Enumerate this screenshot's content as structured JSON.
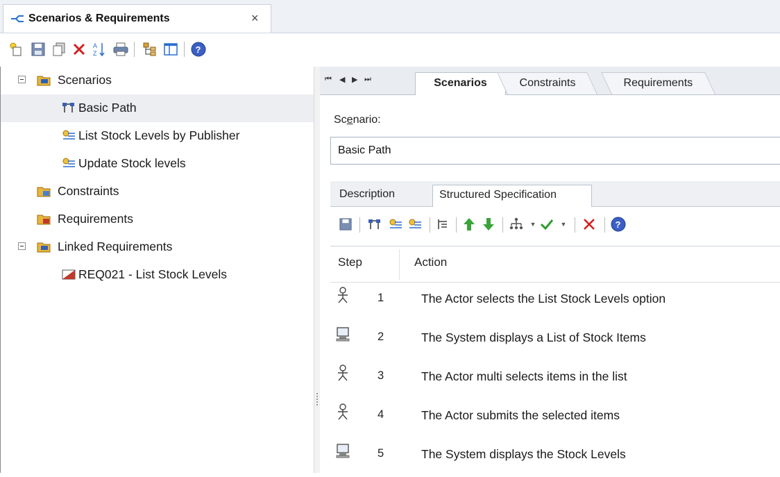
{
  "window": {
    "tab_title": "Scenarios & Requirements",
    "close_glyph": "×"
  },
  "toolbar": {
    "icons": [
      "new-icon",
      "save-icon",
      "copy-icon",
      "delete-icon",
      "sort-icon",
      "print-icon",
      "hierarchy-icon",
      "layout-icon",
      "help-icon"
    ]
  },
  "tree": {
    "items": [
      {
        "label": "Scenarios",
        "icon": "scenarios-folder-icon",
        "expanded": true,
        "level": 0
      },
      {
        "label": "Basic Path",
        "icon": "basic-path-icon",
        "level": 1,
        "selected": true
      },
      {
        "label": "List Stock Levels by Publisher",
        "icon": "alternate-path-icon",
        "level": 1
      },
      {
        "label": "Update Stock levels",
        "icon": "alternate-path-icon",
        "level": 1
      },
      {
        "label": "Constraints",
        "icon": "constraints-folder-icon",
        "level": 0
      },
      {
        "label": "Requirements",
        "icon": "requirements-folder-icon",
        "level": 0
      },
      {
        "label": "Linked Requirements",
        "icon": "linked-requirements-folder-icon",
        "expanded": true,
        "level": 0
      },
      {
        "label": "REQ021 - List Stock Levels",
        "icon": "requirement-icon",
        "level": 1
      }
    ]
  },
  "panel": {
    "nav": [
      "first-icon",
      "previous-icon",
      "next-icon",
      "last-icon"
    ],
    "tabs": [
      {
        "label": "Scenarios",
        "active": true
      },
      {
        "label": "Constraints",
        "active": false
      },
      {
        "label": "Requirements",
        "active": false
      }
    ],
    "scenario_label_pre": "Sc",
    "scenario_label_key": "e",
    "scenario_label_post": "nario:",
    "scenario_value": "Basic Path",
    "sub_tabs": [
      {
        "label": "Description",
        "active": false
      },
      {
        "label": "Structured Specification",
        "active": true
      }
    ],
    "spec_toolbar": {
      "icons": [
        "save-icon",
        "insert-step-icon",
        "alternate-path-icon",
        "exception-path-icon",
        "indent-icon",
        "move-up-icon",
        "move-down-icon",
        "generate-icon",
        "validate-icon",
        "delete-icon",
        "help-icon"
      ]
    },
    "grid": {
      "headers": {
        "step": "Step",
        "action": "Action"
      },
      "rows": [
        {
          "step": "1",
          "actor": "actor-icon",
          "action": "The Actor selects the List Stock Levels option"
        },
        {
          "step": "2",
          "actor": "system-icon",
          "action": "The System displays a List of Stock Items"
        },
        {
          "step": "3",
          "actor": "actor-icon",
          "action": "The Actor multi selects items in the list"
        },
        {
          "step": "4",
          "actor": "actor-icon",
          "action": "The Actor submits the selected items"
        },
        {
          "step": "5",
          "actor": "system-icon",
          "action": "The System displays the Stock Levels"
        }
      ]
    }
  },
  "colors": {
    "accent_blue": "#2a6fcf",
    "delete_red": "#d21f1f",
    "arrow_green": "#3aa43a",
    "folder_yellow": "#e8b63a"
  }
}
